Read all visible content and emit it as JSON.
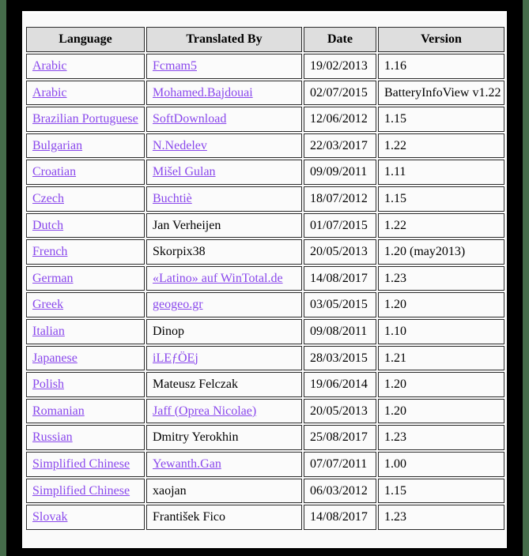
{
  "page": {
    "background_color": "#fafafa",
    "frame_color": "#000000",
    "edge_strip_color": "#456b4a",
    "link_color": "#8a48ec",
    "header_background": "#dedede",
    "border_color": "#2b2b2b"
  },
  "table": {
    "name": "translations-table",
    "columns": [
      {
        "key": "language",
        "label": "Language"
      },
      {
        "key": "translated_by",
        "label": "Translated By"
      },
      {
        "key": "date",
        "label": "Date"
      },
      {
        "key": "version",
        "label": "Version"
      }
    ],
    "rows": [
      {
        "language": "Arabic",
        "language_is_link": true,
        "translated_by": "Fcmam5",
        "translator_is_link": true,
        "date": "19/02/2013",
        "version": "1.16"
      },
      {
        "language": "Arabic",
        "language_is_link": true,
        "translated_by": "Mohamed.Bajdouai",
        "translator_is_link": true,
        "date": "02/07/2015",
        "version": "BatteryInfoView v1.22"
      },
      {
        "language": "Brazilian Portuguese",
        "language_is_link": true,
        "translated_by": "SoftDownload",
        "translator_is_link": true,
        "date": "12/06/2012",
        "version": "1.15"
      },
      {
        "language": "Bulgarian",
        "language_is_link": true,
        "translated_by": "N.Nedelev",
        "translator_is_link": true,
        "date": "22/03/2017",
        "version": "1.22"
      },
      {
        "language": "Croatian",
        "language_is_link": true,
        "translated_by": "Mišel Gulan",
        "translator_is_link": true,
        "date": "09/09/2011",
        "version": "1.11"
      },
      {
        "language": "Czech",
        "language_is_link": true,
        "translated_by": "Buchtiè",
        "translator_is_link": true,
        "date": "18/07/2012",
        "version": "1.15"
      },
      {
        "language": "Dutch",
        "language_is_link": true,
        "translated_by": "Jan Verheijen",
        "translator_is_link": false,
        "date": "01/07/2015",
        "version": "1.22"
      },
      {
        "language": "French",
        "language_is_link": true,
        "translated_by": "Skorpix38",
        "translator_is_link": false,
        "date": "20/05/2013",
        "version": "1.20 (may2013)"
      },
      {
        "language": "German",
        "language_is_link": true,
        "translated_by": "«Latino» auf WinTotal.de",
        "translator_is_link": true,
        "date": "14/08/2017",
        "version": "1.23"
      },
      {
        "language": "Greek",
        "language_is_link": true,
        "translated_by": "geogeo.gr",
        "translator_is_link": true,
        "date": "03/05/2015",
        "version": "1.20"
      },
      {
        "language": "Italian",
        "language_is_link": true,
        "translated_by": "Dinop",
        "translator_is_link": false,
        "date": "09/08/2011",
        "version": "1.10"
      },
      {
        "language": "Japanese",
        "language_is_link": true,
        "translated_by": "iLEƒÖEj",
        "translator_is_link": true,
        "date": "28/03/2015",
        "version": "1.21"
      },
      {
        "language": "Polish",
        "language_is_link": true,
        "translated_by": "Mateusz Felczak",
        "translator_is_link": false,
        "date": "19/06/2014",
        "version": "1.20"
      },
      {
        "language": "Romanian",
        "language_is_link": true,
        "translated_by": "Jaff (Oprea Nicolae)",
        "translator_is_link": true,
        "date": "20/05/2013",
        "version": "1.20"
      },
      {
        "language": "Russian",
        "language_is_link": true,
        "translated_by": "Dmitry Yerokhin",
        "translator_is_link": false,
        "date": "25/08/2017",
        "version": "1.23"
      },
      {
        "language": "Simplified Chinese",
        "language_is_link": true,
        "translated_by": "Yewanth.Gan",
        "translator_is_link": true,
        "date": "07/07/2011",
        "version": "1.00"
      },
      {
        "language": "Simplified Chinese",
        "language_is_link": true,
        "translated_by": "xaojan",
        "translator_is_link": false,
        "date": "06/03/2012",
        "version": "1.15"
      },
      {
        "language": "Slovak",
        "language_is_link": true,
        "translated_by": "František Fico",
        "translator_is_link": false,
        "date": "14/08/2017",
        "version": "1.23"
      }
    ]
  }
}
